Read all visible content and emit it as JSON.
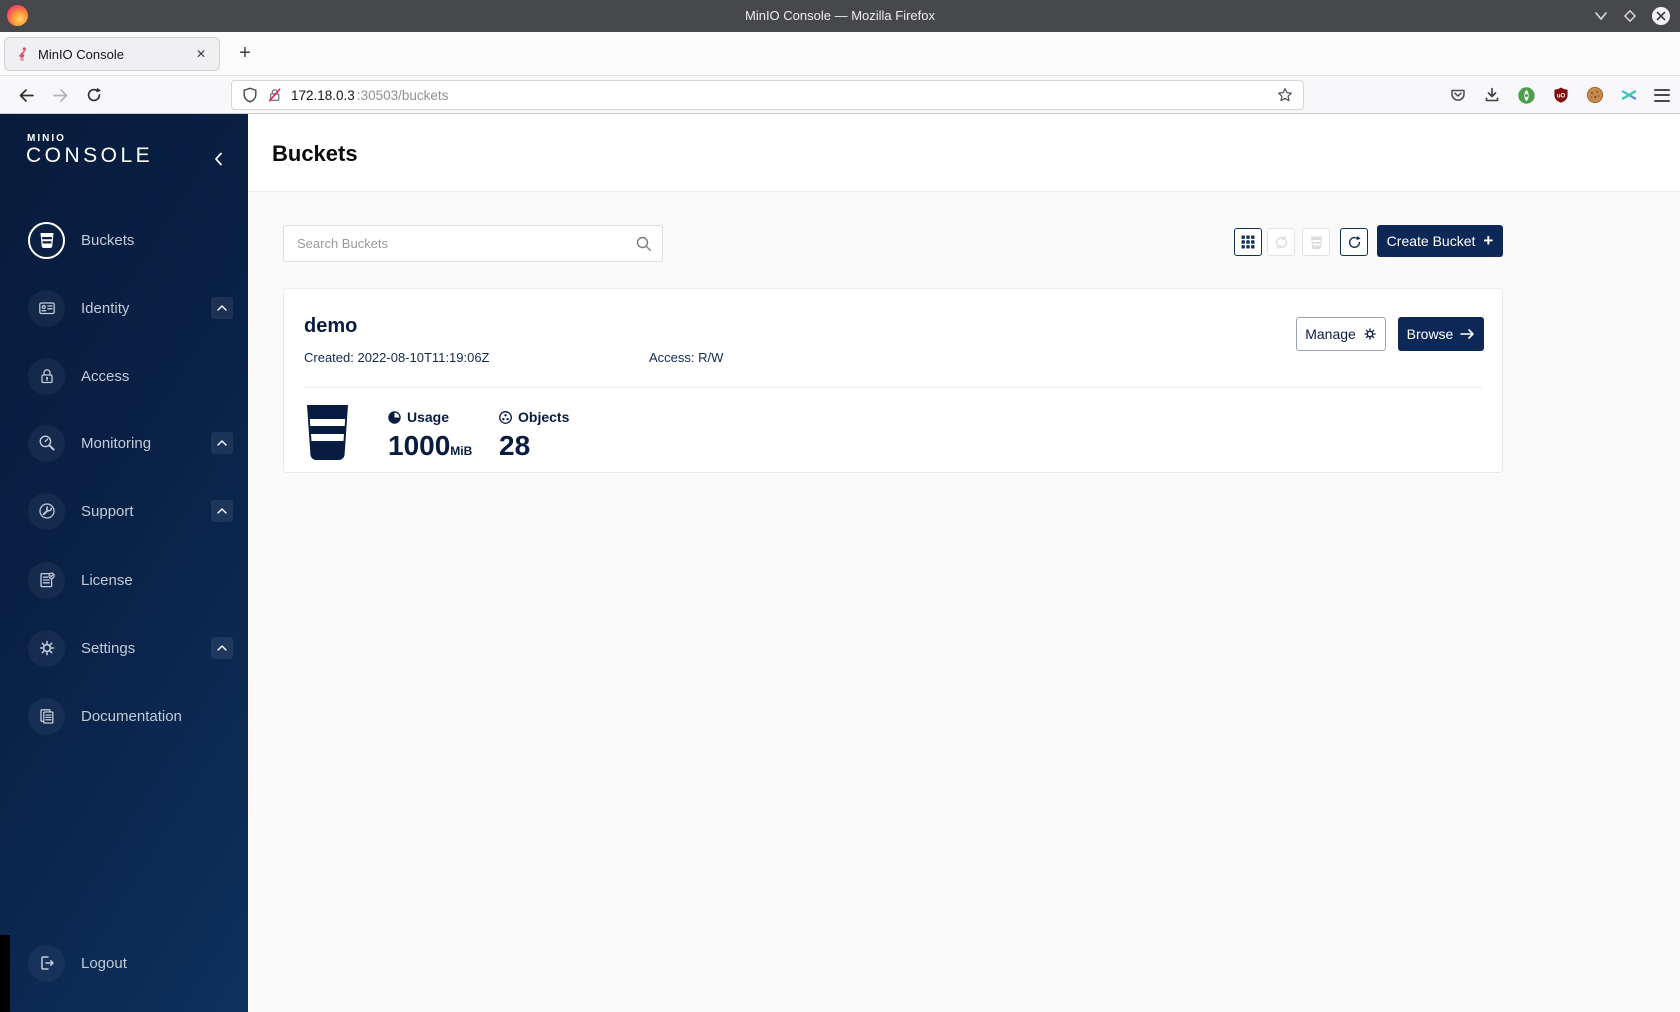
{
  "window": {
    "title": "MinIO Console — Mozilla Firefox"
  },
  "browser": {
    "tab_title": "MinIO Console",
    "url": {
      "host": "172.18.0.3",
      "path": ":30503/buckets"
    }
  },
  "sidebar": {
    "logo_line1": "MINIO",
    "logo_line2": "CONSOLE",
    "items": [
      {
        "label": "Buckets",
        "active": true
      },
      {
        "label": "Identity",
        "expandable": true
      },
      {
        "label": "Access"
      },
      {
        "label": "Monitoring",
        "expandable": true
      },
      {
        "label": "Support",
        "expandable": true
      },
      {
        "label": "License"
      },
      {
        "label": "Settings",
        "expandable": true
      },
      {
        "label": "Documentation"
      }
    ],
    "logout": "Logout"
  },
  "page": {
    "title": "Buckets",
    "search_placeholder": "Search Buckets",
    "create_button": "Create Bucket"
  },
  "bucket": {
    "name": "demo",
    "created": "Created: 2022-08-10T11:19:06Z",
    "access": "Access: R/W",
    "manage": "Manage",
    "browse": "Browse",
    "usage_label": "Usage",
    "usage_value": "1000",
    "usage_unit": "MiB",
    "objects_label": "Objects",
    "objects_value": "28"
  },
  "icons": {
    "plus": "+",
    "new_tab": "+",
    "close_tab": "✕"
  },
  "colors": {
    "titlebar_bg": "#47484C",
    "sidebar_gradient_start": "#081B3C",
    "sidebar_gradient_end": "#0D315E",
    "sidebar_text": "#C3CBD7",
    "navy_dark": "#081C42",
    "navy_button": "#0D2857",
    "content_bg": "#FAFAFA",
    "insecure_strike": "#E22850",
    "ublock_red": "#800F12"
  }
}
